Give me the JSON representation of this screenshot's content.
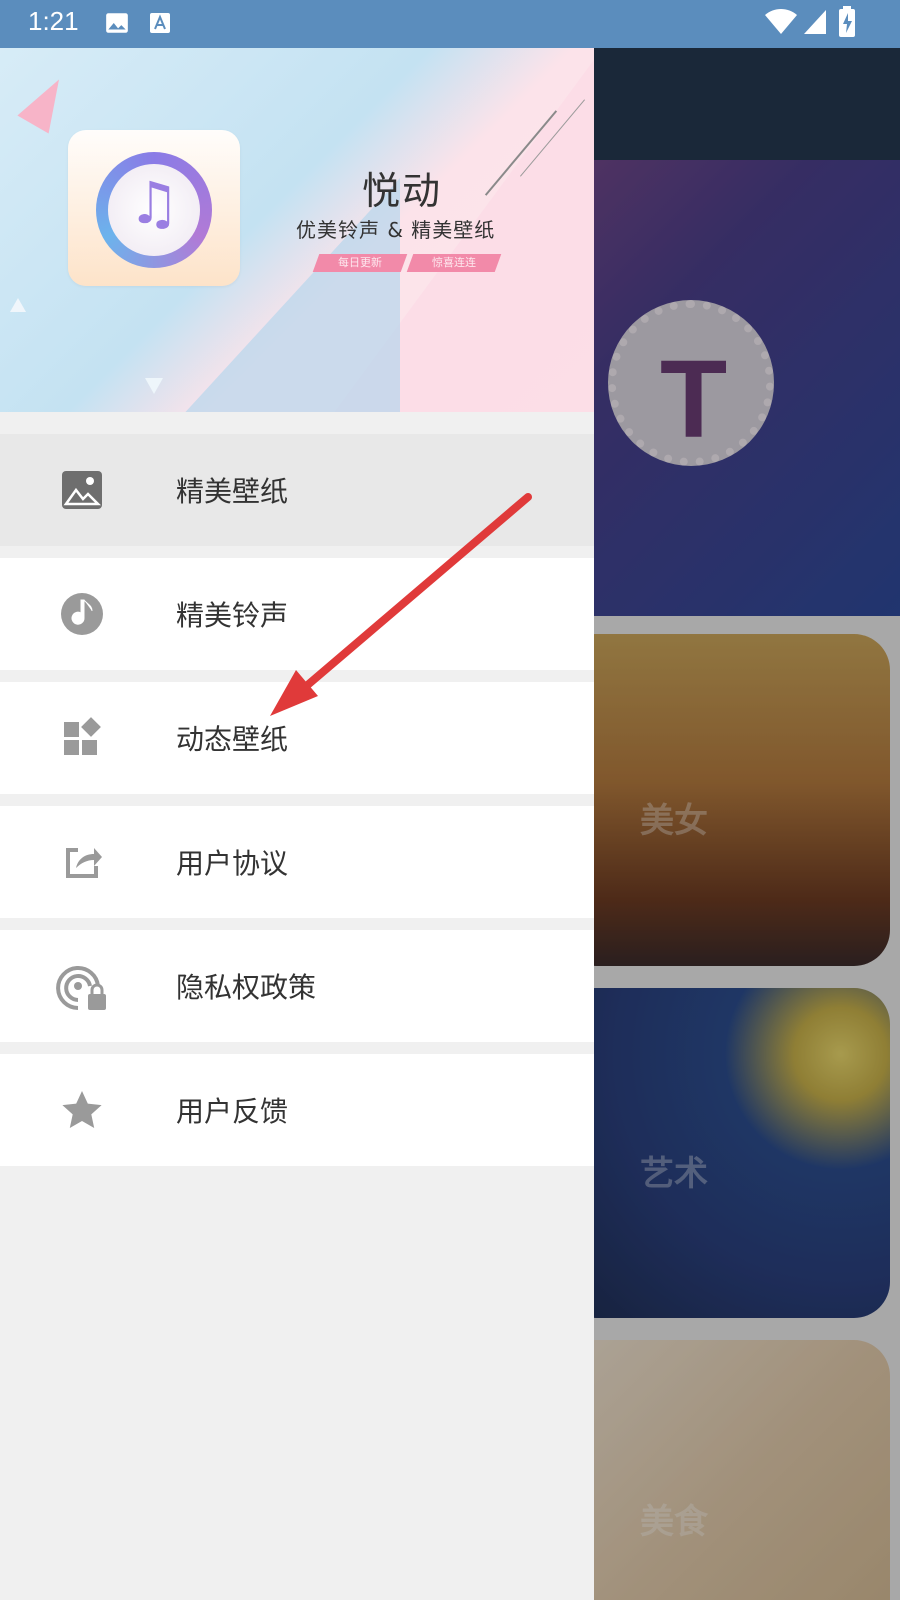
{
  "status_bar": {
    "time": "1:21"
  },
  "drawer": {
    "header": {
      "title": "悦动",
      "subtitle": "优美铃声 & 精美壁纸",
      "tags": [
        "每日更新",
        "惊喜连连"
      ]
    },
    "menu": [
      {
        "label": "精美壁纸",
        "icon": "image-icon",
        "active": true
      },
      {
        "label": "精美铃声",
        "icon": "music-note-icon",
        "active": false
      },
      {
        "label": "动态壁纸",
        "icon": "widgets-icon",
        "active": false
      },
      {
        "label": "用户协议",
        "icon": "share-icon",
        "active": false
      },
      {
        "label": "隐私权政策",
        "icon": "privacy-lock-icon",
        "active": false
      },
      {
        "label": "用户反馈",
        "icon": "star-icon",
        "active": false
      }
    ]
  },
  "background": {
    "cards": [
      {
        "label": "美女"
      },
      {
        "label": "艺术"
      },
      {
        "label": "美食"
      }
    ]
  },
  "colors": {
    "status_bar": "#5b8dbd",
    "arrow": "#e03a3a",
    "menu_icon": "#8a8a8a"
  }
}
